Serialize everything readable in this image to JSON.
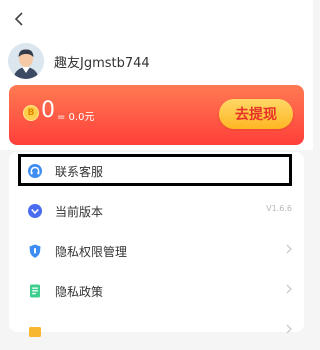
{
  "user": {
    "name": "趣友Jgmstb744"
  },
  "balance": {
    "coin_label": "B",
    "coins": "0",
    "equivalent": "= 0.0元",
    "withdraw_label": "去提现"
  },
  "menu": {
    "items": [
      {
        "label": "联系客服",
        "icon": "customer-service-icon",
        "trailing": ""
      },
      {
        "label": "当前版本",
        "icon": "version-icon",
        "trailing": "V1.6.6"
      },
      {
        "label": "隐私权限管理",
        "icon": "shield-icon",
        "trailing": ""
      },
      {
        "label": "隐私政策",
        "icon": "document-icon",
        "trailing": ""
      }
    ]
  },
  "colors": {
    "card_gradient_top": "#ff7a52",
    "card_gradient_bottom": "#ff3f3a",
    "button_gold": "#ffc43d",
    "icon_blue": "#3d8df2",
    "icon_green": "#3ecf8e"
  }
}
